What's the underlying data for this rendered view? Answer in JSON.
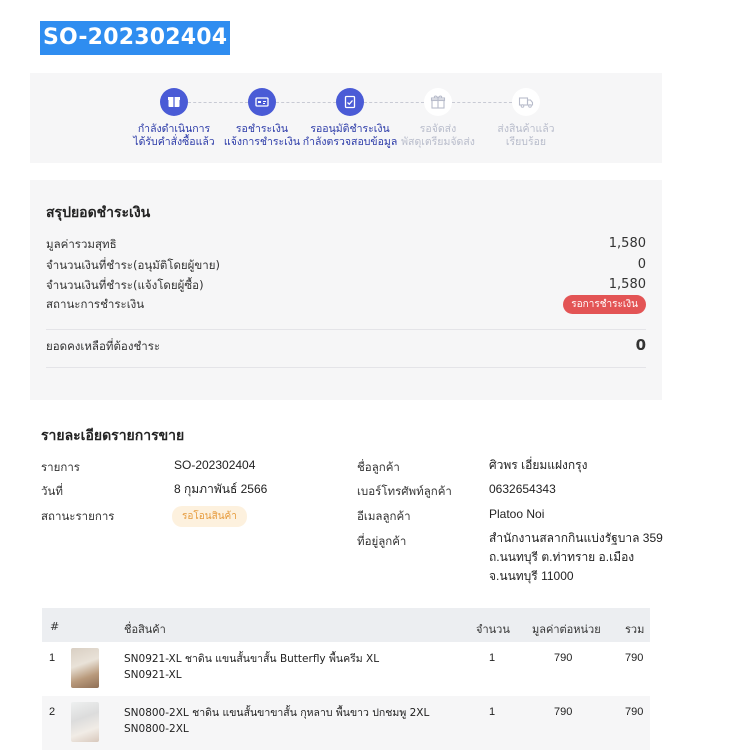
{
  "order": {
    "title": "SO-202302404"
  },
  "steps": [
    {
      "line1": "กำลังดำเนินการ",
      "line2": "ได้รับคำสั่งซื้อแล้ว",
      "icon": "box-icon",
      "state": "active"
    },
    {
      "line1": "รอชำระเงิน",
      "line2": "แจ้งการชำระเงิน",
      "icon": "payment-card-icon",
      "state": "active"
    },
    {
      "line1": "รออนุมัติชำระเงิน",
      "line2": "กำลังตรวจสอบข้อมูล",
      "icon": "document-check-icon",
      "state": "active"
    },
    {
      "line1": "รอจัดส่ง",
      "line2": "พัสดุเตรียมจัดส่ง",
      "icon": "gift-box-icon",
      "state": "inactive"
    },
    {
      "line1": "ส่งสินค้าแล้ว",
      "line2": "เรียบร้อย",
      "icon": "truck-icon",
      "state": "inactive"
    }
  ],
  "summary": {
    "title": "สรุปยอดชำระเงิน",
    "net_total_label": "มูลค่ารวมสุทธิ",
    "net_total_value": "1,580",
    "paid_seller_label": "จำนวนเงินที่ชำระ(อนุมัติโดยผู้ขาย)",
    "paid_seller_value": "0",
    "paid_buyer_label": "จำนวนเงินที่ชำระ(แจ้งโดยผู้ซื้อ)",
    "paid_buyer_value": "1,580",
    "status_label": "สถานะการชำระเงิน",
    "status_value": "รอการชำระเงิน",
    "balance_label": "ยอดคงเหลือที่ต้องชำระ",
    "balance_value": "0"
  },
  "detail": {
    "title": "รายละเอียดรายการขาย",
    "item_label": "รายการ",
    "item_value": "SO-202302404",
    "date_label": "วันที่",
    "date_value": "8 กุมภาพันธ์ 2566",
    "status_label": "สถานะรายการ",
    "status_value": "รอโอนสินค้า",
    "customer_name_label": "ชื่อลูกค้า",
    "customer_name_value": "ศิวพร เอี่ยมแฝงกรุง",
    "phone_label": "เบอร์โทรศัพท์ลูกค้า",
    "phone_value": "0632654343",
    "email_label": "อีเมลลูกค้า",
    "email_value": "Platoo Noi",
    "address_label": "ที่อยู่ลูกค้า",
    "address_line1": "สำนักงานสลากกินแบ่งรัฐบาล 359",
    "address_line2": "ถ.นนทบุรี ต.ท่าทราย อ.เมือง",
    "address_line3": "จ.นนทบุรี 11000"
  },
  "table": {
    "headers": {
      "index": "#",
      "name": "ชื่อสินค้า",
      "qty": "จำนวน",
      "unit_price": "มูลค่าต่อหน่วย",
      "total": "รวม"
    },
    "rows": [
      {
        "index": "1",
        "name": "SN0921-XL ชาดิน แขนสั้นขาสั้น Butterfly พื้นครีม XL",
        "sku": "SN0921-XL",
        "qty": "1",
        "unit_price": "790",
        "total": "790"
      },
      {
        "index": "2",
        "name": "SN0800-2XL ชาดิน แขนสั้นขาขาสั้น กุหลาบ พื้นขาว ปกชมพู 2XL",
        "sku": "SN0800-2XL",
        "qty": "1",
        "unit_price": "790",
        "total": "790"
      }
    ]
  }
}
